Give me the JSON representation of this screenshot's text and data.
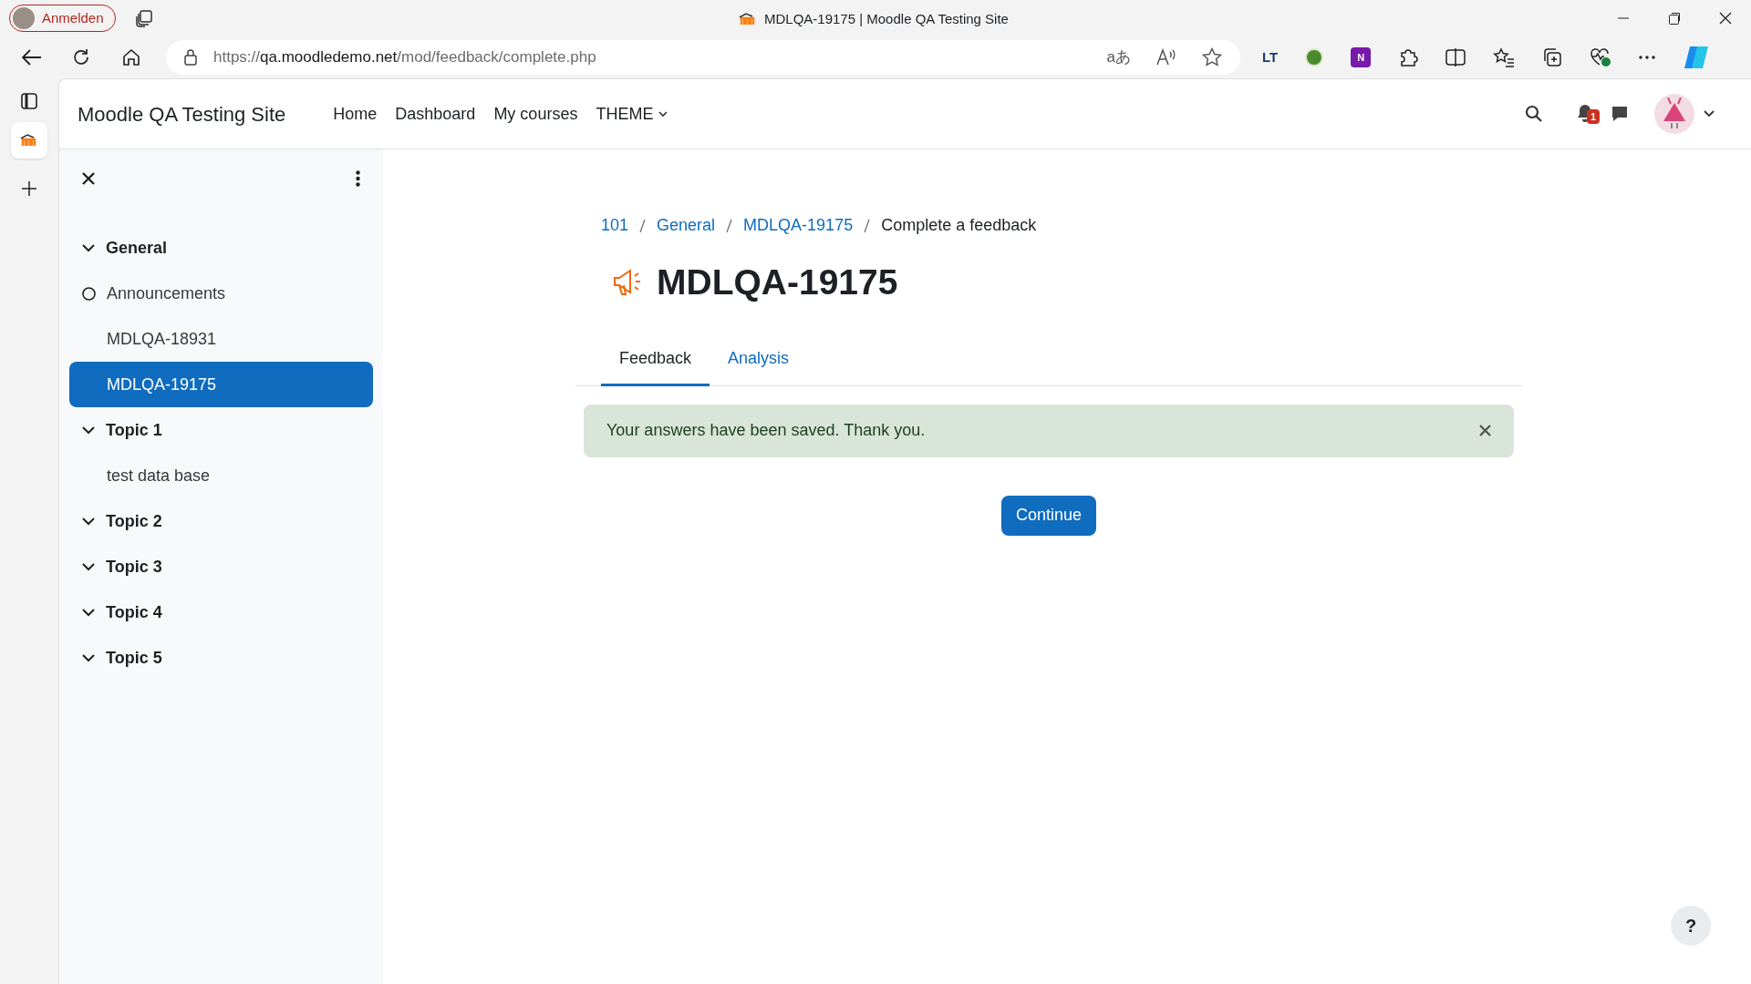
{
  "browser": {
    "profile_button": "Anmelden",
    "tab_title": "MDLQA-19175 | Moodle QA Testing Site",
    "address_bar_icons": {
      "translate": "aあ"
    },
    "extensions": {
      "languagetool": "LT",
      "onenote": "N"
    },
    "url": {
      "scheme": "https://",
      "host": "qa.moodledemo.net",
      "path": "/mod/feedback/complete.php"
    }
  },
  "header": {
    "site_name": "Moodle QA Testing Site",
    "nav": [
      {
        "label": "Home",
        "dropdown": false
      },
      {
        "label": "Dashboard",
        "dropdown": false
      },
      {
        "label": "My courses",
        "dropdown": false
      },
      {
        "label": "THEME",
        "dropdown": true
      }
    ],
    "notification_count": "1"
  },
  "sidebar": {
    "items": [
      {
        "kind": "section",
        "label": "General",
        "expanded": true,
        "children": [
          {
            "kind": "activity",
            "label": "Announcements",
            "marker": true,
            "selected": false
          },
          {
            "kind": "activity",
            "label": "MDLQA-18931",
            "marker": false,
            "selected": false
          },
          {
            "kind": "activity",
            "label": "MDLQA-19175",
            "marker": false,
            "selected": true
          }
        ]
      },
      {
        "kind": "section",
        "label": "Topic 1",
        "expanded": true,
        "children": [
          {
            "kind": "activity",
            "label": "test data base",
            "marker": false,
            "selected": false
          }
        ]
      },
      {
        "kind": "section",
        "label": "Topic 2",
        "expanded": true
      },
      {
        "kind": "section",
        "label": "Topic 3",
        "expanded": true
      },
      {
        "kind": "section",
        "label": "Topic 4",
        "expanded": true
      },
      {
        "kind": "section",
        "label": "Topic 5",
        "expanded": true
      }
    ]
  },
  "breadcrumb": [
    {
      "label": "101",
      "link": true
    },
    {
      "label": "General",
      "link": true
    },
    {
      "label": "MDLQA-19175",
      "link": true
    },
    {
      "label": "Complete a feedback",
      "link": false
    }
  ],
  "heading": "MDLQA-19175",
  "tabs": [
    {
      "label": "Feedback",
      "selected": true
    },
    {
      "label": "Analysis",
      "selected": false
    }
  ],
  "alert": {
    "message": "Your answers have been saved. Thank you."
  },
  "continue_button": "Continue",
  "help_button": "?"
}
